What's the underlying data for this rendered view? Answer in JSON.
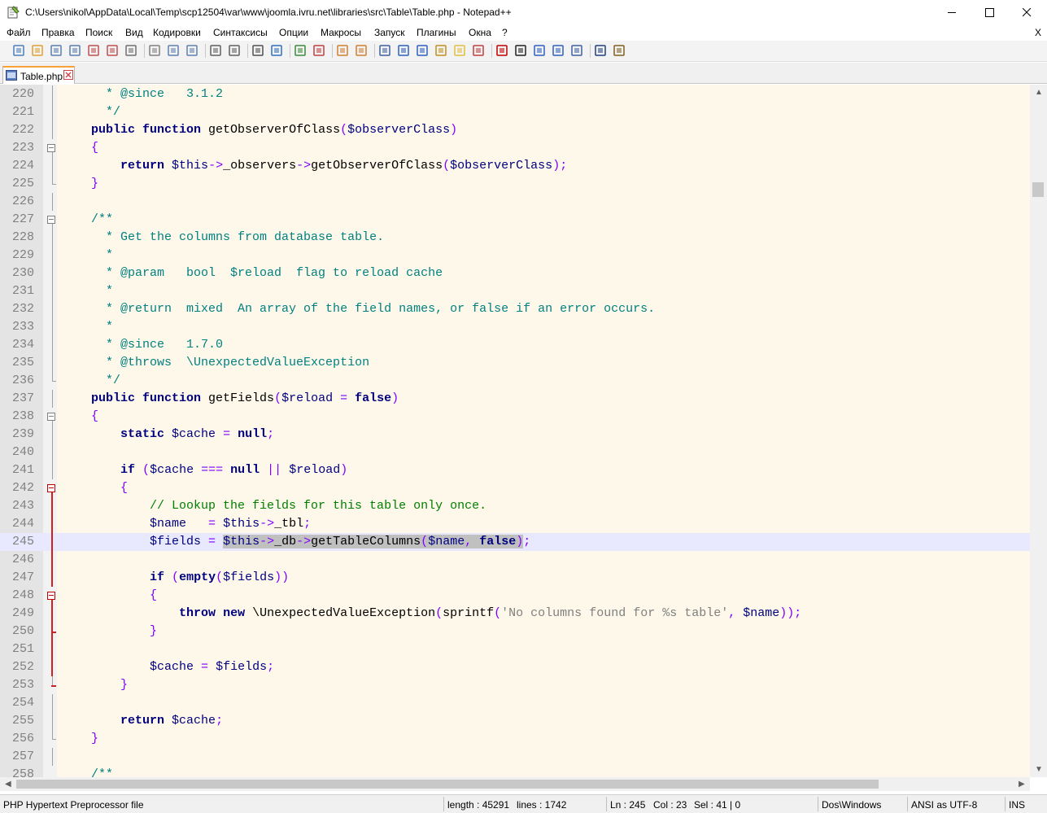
{
  "window": {
    "title": "C:\\Users\\nikol\\AppData\\Local\\Temp\\scp12504\\var\\www\\joomla.ivru.net\\libraries\\src\\Table\\Table.php - Notepad++",
    "app_icon": "notepad-plus-plus-icon",
    "controls": [
      "minimize-icon",
      "maximize-icon",
      "close-icon"
    ]
  },
  "menu": {
    "items": [
      "Файл",
      "Правка",
      "Поиск",
      "Вид",
      "Кодировки",
      "Синтаксисы",
      "Опции",
      "Макросы",
      "Запуск",
      "Плагины",
      "Окна",
      "?"
    ],
    "close_doc": "X"
  },
  "toolbar": {
    "icons": [
      "new-file-icon",
      "open-file-icon",
      "save-icon",
      "save-all-icon",
      "close-icon",
      "close-all-icon",
      "print-icon",
      "cut-icon",
      "copy-icon",
      "paste-icon",
      "undo-icon",
      "redo-icon",
      "find-icon",
      "replace-icon",
      "zoom-in-icon",
      "zoom-out-icon",
      "sync-vertical-icon",
      "sync-horizontal-icon",
      "word-wrap-icon",
      "show-all-chars-icon",
      "indent-guide-icon",
      "user-language-icon",
      "doc-map-icon",
      "function-list-icon",
      "record-macro-icon",
      "stop-record-icon",
      "play-macro-icon",
      "run-macro-multiple-icon",
      "save-macro-icon",
      "spellcheck-icon",
      "spellcheck-settings-icon"
    ]
  },
  "tabs": [
    {
      "label": "Table.php",
      "icon": "php-file-icon",
      "active": true
    }
  ],
  "editor": {
    "lines": [
      {
        "n": "220",
        "tokens": [
          [
            "  ",
            ""
          ],
          [
            "* @since   3.1.2",
            "doc"
          ]
        ]
      },
      {
        "n": "221",
        "tokens": [
          [
            "  ",
            ""
          ],
          [
            "*/",
            "doc"
          ]
        ]
      },
      {
        "n": "222",
        "tokens": [
          [
            "public",
            "kw"
          ],
          [
            " ",
            ""
          ],
          [
            "function",
            "kw"
          ],
          [
            " getObserverOfClass",
            ""
          ],
          [
            "(",
            "op"
          ],
          [
            "$observerClass",
            "var"
          ],
          [
            ")",
            "op"
          ]
        ]
      },
      {
        "n": "223",
        "tokens": [
          [
            "{",
            "op"
          ]
        ]
      },
      {
        "n": "224",
        "tokens": [
          [
            "    ",
            ""
          ],
          [
            "return",
            "kw"
          ],
          [
            " ",
            ""
          ],
          [
            "$this",
            "var"
          ],
          [
            "->",
            "op"
          ],
          [
            "_observers",
            ""
          ],
          [
            "->",
            "op"
          ],
          [
            "getObserverOfClass",
            ""
          ],
          [
            "(",
            "op"
          ],
          [
            "$observerClass",
            "var"
          ],
          [
            ");",
            "op"
          ]
        ]
      },
      {
        "n": "225",
        "tokens": [
          [
            "}",
            "op"
          ]
        ]
      },
      {
        "n": "226",
        "tokens": []
      },
      {
        "n": "227",
        "tokens": [
          [
            "/**",
            "doc"
          ]
        ]
      },
      {
        "n": "228",
        "tokens": [
          [
            "  ",
            ""
          ],
          [
            "* Get the columns from database table.",
            "doc"
          ]
        ]
      },
      {
        "n": "229",
        "tokens": [
          [
            "  ",
            ""
          ],
          [
            "*",
            "doc"
          ]
        ]
      },
      {
        "n": "230",
        "tokens": [
          [
            "  ",
            ""
          ],
          [
            "* @param   bool  $reload  flag to reload cache",
            "doc"
          ]
        ]
      },
      {
        "n": "231",
        "tokens": [
          [
            "  ",
            ""
          ],
          [
            "*",
            "doc"
          ]
        ]
      },
      {
        "n": "232",
        "tokens": [
          [
            "  ",
            ""
          ],
          [
            "* @return  mixed  An array of the field names, or false if an error occurs.",
            "doc"
          ]
        ]
      },
      {
        "n": "233",
        "tokens": [
          [
            "  ",
            ""
          ],
          [
            "*",
            "doc"
          ]
        ]
      },
      {
        "n": "234",
        "tokens": [
          [
            "  ",
            ""
          ],
          [
            "* @since   1.7.0",
            "doc"
          ]
        ]
      },
      {
        "n": "235",
        "tokens": [
          [
            "  ",
            ""
          ],
          [
            "* @throws  \\UnexpectedValueException",
            "doc"
          ]
        ]
      },
      {
        "n": "236",
        "tokens": [
          [
            "  ",
            ""
          ],
          [
            "*/",
            "doc"
          ]
        ]
      },
      {
        "n": "237",
        "tokens": [
          [
            "public",
            "kw"
          ],
          [
            " ",
            ""
          ],
          [
            "function",
            "kw"
          ],
          [
            " getFields",
            ""
          ],
          [
            "(",
            "op"
          ],
          [
            "$reload",
            "var"
          ],
          [
            " ",
            ""
          ],
          [
            "=",
            "op"
          ],
          [
            " ",
            ""
          ],
          [
            "false",
            "kw"
          ],
          [
            ")",
            "op"
          ]
        ]
      },
      {
        "n": "238",
        "tokens": [
          [
            "{",
            "op"
          ]
        ]
      },
      {
        "n": "239",
        "tokens": [
          [
            "    ",
            ""
          ],
          [
            "static",
            "kw"
          ],
          [
            " ",
            ""
          ],
          [
            "$cache",
            "var"
          ],
          [
            " ",
            ""
          ],
          [
            "=",
            "op"
          ],
          [
            " ",
            ""
          ],
          [
            "null",
            "kw"
          ],
          [
            ";",
            "op"
          ]
        ]
      },
      {
        "n": "240",
        "tokens": []
      },
      {
        "n": "241",
        "tokens": [
          [
            "    ",
            ""
          ],
          [
            "if",
            "kw"
          ],
          [
            " ",
            ""
          ],
          [
            "(",
            "op"
          ],
          [
            "$cache",
            "var"
          ],
          [
            " ",
            ""
          ],
          [
            "===",
            "op"
          ],
          [
            " ",
            ""
          ],
          [
            "null",
            "kw"
          ],
          [
            " ",
            ""
          ],
          [
            "||",
            "op"
          ],
          [
            " ",
            ""
          ],
          [
            "$reload",
            "var"
          ],
          [
            ")",
            "op"
          ]
        ]
      },
      {
        "n": "242",
        "tokens": [
          [
            "    ",
            ""
          ],
          [
            "{",
            "op"
          ]
        ]
      },
      {
        "n": "243",
        "tokens": [
          [
            "        ",
            ""
          ],
          [
            "// Lookup the fields for this table only once.",
            "cmt"
          ]
        ]
      },
      {
        "n": "244",
        "tokens": [
          [
            "        ",
            ""
          ],
          [
            "$name",
            "var"
          ],
          [
            "   ",
            ""
          ],
          [
            "=",
            "op"
          ],
          [
            " ",
            ""
          ],
          [
            "$this",
            "var"
          ],
          [
            "->",
            "op"
          ],
          [
            "_tbl",
            ""
          ],
          [
            ";",
            "op"
          ]
        ]
      },
      {
        "n": "245",
        "tokens": [
          [
            "        ",
            ""
          ],
          [
            "$fields",
            "var"
          ],
          [
            " ",
            ""
          ],
          [
            "=",
            "op"
          ],
          [
            " ",
            ""
          ],
          [
            "$this",
            "var sel"
          ],
          [
            "->",
            "op sel"
          ],
          [
            "_db",
            "sel"
          ],
          [
            "->",
            "op sel"
          ],
          [
            "getTableColumns",
            "sel"
          ],
          [
            "(",
            "op sel"
          ],
          [
            "$name",
            "var sel"
          ],
          [
            ",",
            "op sel"
          ],
          [
            " ",
            "sel"
          ],
          [
            "false",
            "kw sel"
          ],
          [
            ")",
            "op sel"
          ],
          [
            ";",
            "op"
          ]
        ]
      },
      {
        "n": "246",
        "tokens": []
      },
      {
        "n": "247",
        "tokens": [
          [
            "        ",
            ""
          ],
          [
            "if",
            "kw"
          ],
          [
            " ",
            ""
          ],
          [
            "(",
            "op"
          ],
          [
            "empty",
            "kw"
          ],
          [
            "(",
            "op"
          ],
          [
            "$fields",
            "var"
          ],
          [
            "))",
            "op"
          ]
        ]
      },
      {
        "n": "248",
        "tokens": [
          [
            "        ",
            ""
          ],
          [
            "{",
            "op"
          ]
        ]
      },
      {
        "n": "249",
        "tokens": [
          [
            "            ",
            ""
          ],
          [
            "throw",
            "kw"
          ],
          [
            " ",
            ""
          ],
          [
            "new",
            "kw"
          ],
          [
            " \\UnexpectedValueException",
            ""
          ],
          [
            "(",
            "op"
          ],
          [
            "sprintf",
            ""
          ],
          [
            "(",
            "op"
          ],
          [
            "'No columns found for %s table'",
            "str"
          ],
          [
            ",",
            "op"
          ],
          [
            " ",
            ""
          ],
          [
            "$name",
            "var"
          ],
          [
            "));",
            "op"
          ]
        ]
      },
      {
        "n": "250",
        "tokens": [
          [
            "        ",
            ""
          ],
          [
            "}",
            "op"
          ]
        ]
      },
      {
        "n": "251",
        "tokens": []
      },
      {
        "n": "252",
        "tokens": [
          [
            "        ",
            ""
          ],
          [
            "$cache",
            "var"
          ],
          [
            " ",
            ""
          ],
          [
            "=",
            "op"
          ],
          [
            " ",
            ""
          ],
          [
            "$fields",
            "var"
          ],
          [
            ";",
            "op"
          ]
        ]
      },
      {
        "n": "253",
        "tokens": [
          [
            "    ",
            ""
          ],
          [
            "}",
            "op"
          ]
        ]
      },
      {
        "n": "254",
        "tokens": []
      },
      {
        "n": "255",
        "tokens": [
          [
            "    ",
            ""
          ],
          [
            "return",
            "kw"
          ],
          [
            " ",
            ""
          ],
          [
            "$cache",
            "var"
          ],
          [
            ";",
            "op"
          ]
        ]
      },
      {
        "n": "256",
        "tokens": [
          [
            "}",
            "op"
          ]
        ]
      },
      {
        "n": "257",
        "tokens": []
      },
      {
        "n": "258",
        "tokens": [
          [
            "/**",
            "doc"
          ]
        ]
      }
    ]
  },
  "statusbar": {
    "filetype": "PHP Hypertext Preprocessor file",
    "length": "length : 45291",
    "lines": "lines : 1742",
    "ln": "Ln : 245",
    "col": "Col : 23",
    "sel": "Sel : 41 | 0",
    "eol": "Dos\\Windows",
    "encoding": "ANSI as UTF-8",
    "mode": "INS"
  }
}
